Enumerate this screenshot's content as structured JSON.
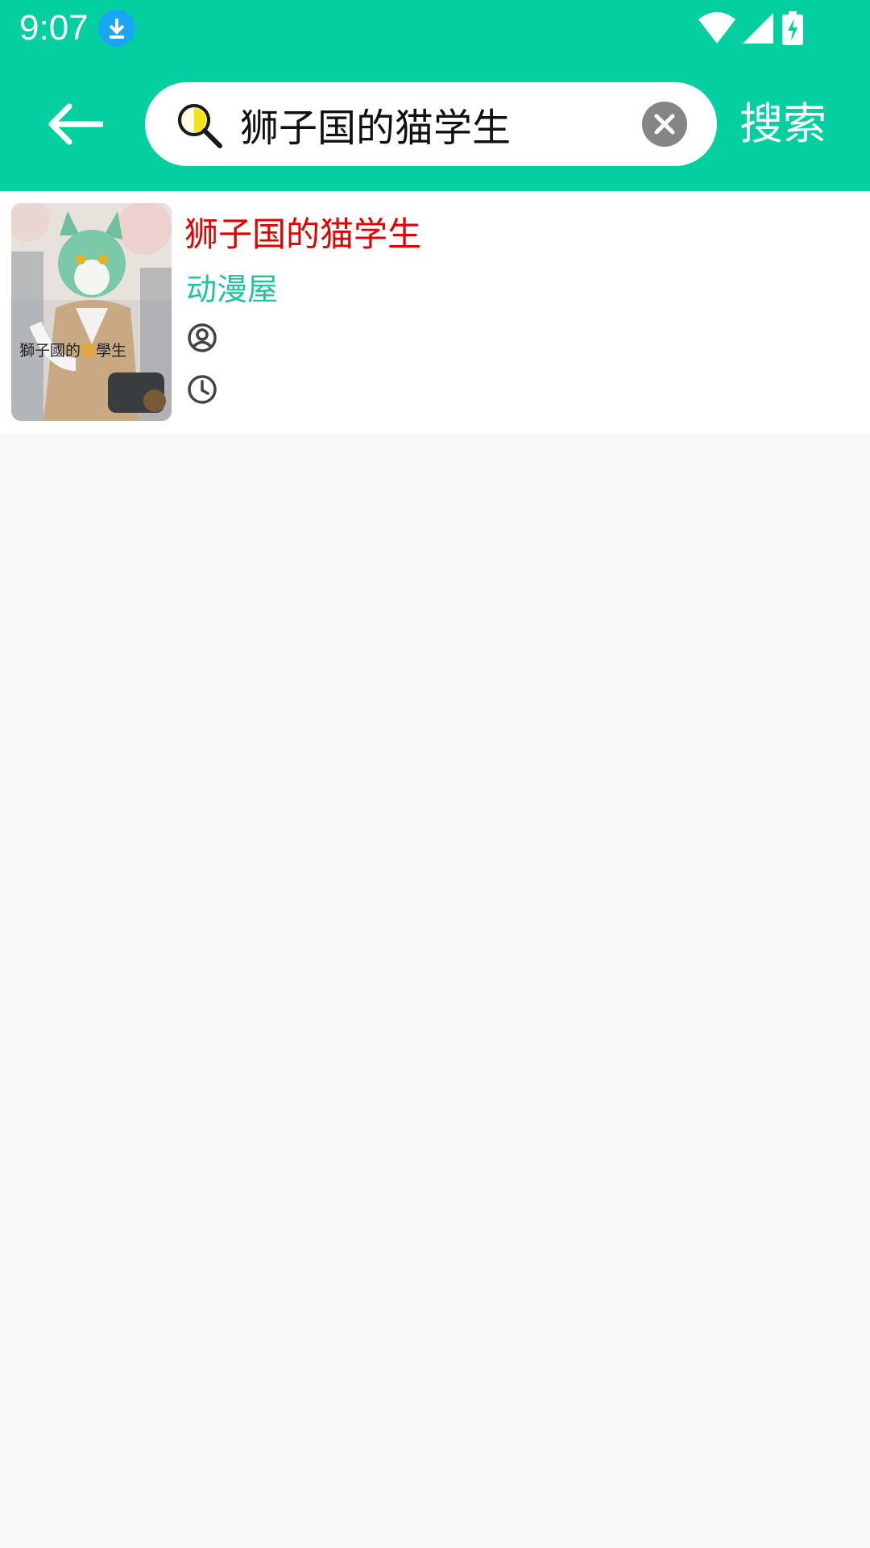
{
  "status_bar": {
    "time": "9:07",
    "download_icon": "download-notification-icon",
    "icons": [
      "wifi-icon",
      "cell-signal-icon",
      "battery-charging-icon"
    ]
  },
  "toolbar": {
    "back_icon": "back-arrow-icon",
    "search_icon": "magnifier-icon",
    "search_value": "狮子国的猫学生",
    "clear_icon": "clear-circle-icon",
    "search_button_label": "搜索"
  },
  "results": [
    {
      "title": "狮子国的猫学生",
      "source": "动漫屋",
      "author": "",
      "updated": "",
      "cover_caption_pre": "獅子國的",
      "cover_caption_hl": "貓",
      "cover_caption_post": "學生"
    }
  ],
  "colors": {
    "accent": "#03cfa1",
    "title": "#e30000",
    "source": "#1ec5a0",
    "background": "#f9f9f9"
  }
}
